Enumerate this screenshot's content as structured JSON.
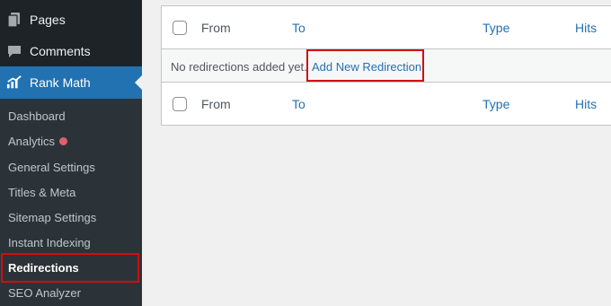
{
  "sidebar": {
    "pages_label": "Pages",
    "comments_label": "Comments",
    "rankmath_label": "Rank Math",
    "submenu": [
      {
        "label": "Dashboard"
      },
      {
        "label": "Analytics"
      },
      {
        "label": "General Settings"
      },
      {
        "label": "Titles & Meta"
      },
      {
        "label": "Sitemap Settings"
      },
      {
        "label": "Instant Indexing"
      },
      {
        "label": "Redirections"
      },
      {
        "label": "SEO Analyzer"
      }
    ],
    "active_item": "Redirections",
    "analytics_badge_color": "#e0606a"
  },
  "table": {
    "columns": {
      "from": "From",
      "to": "To",
      "type": "Type",
      "hits": "Hits"
    },
    "empty_message": "No redirections added yet.",
    "add_new_link": "Add New Redirection"
  },
  "colors": {
    "sidebar_bg": "#1d2327",
    "submenu_bg": "#2c3338",
    "accent": "#2271b1",
    "highlight_border": "#d10b12"
  }
}
